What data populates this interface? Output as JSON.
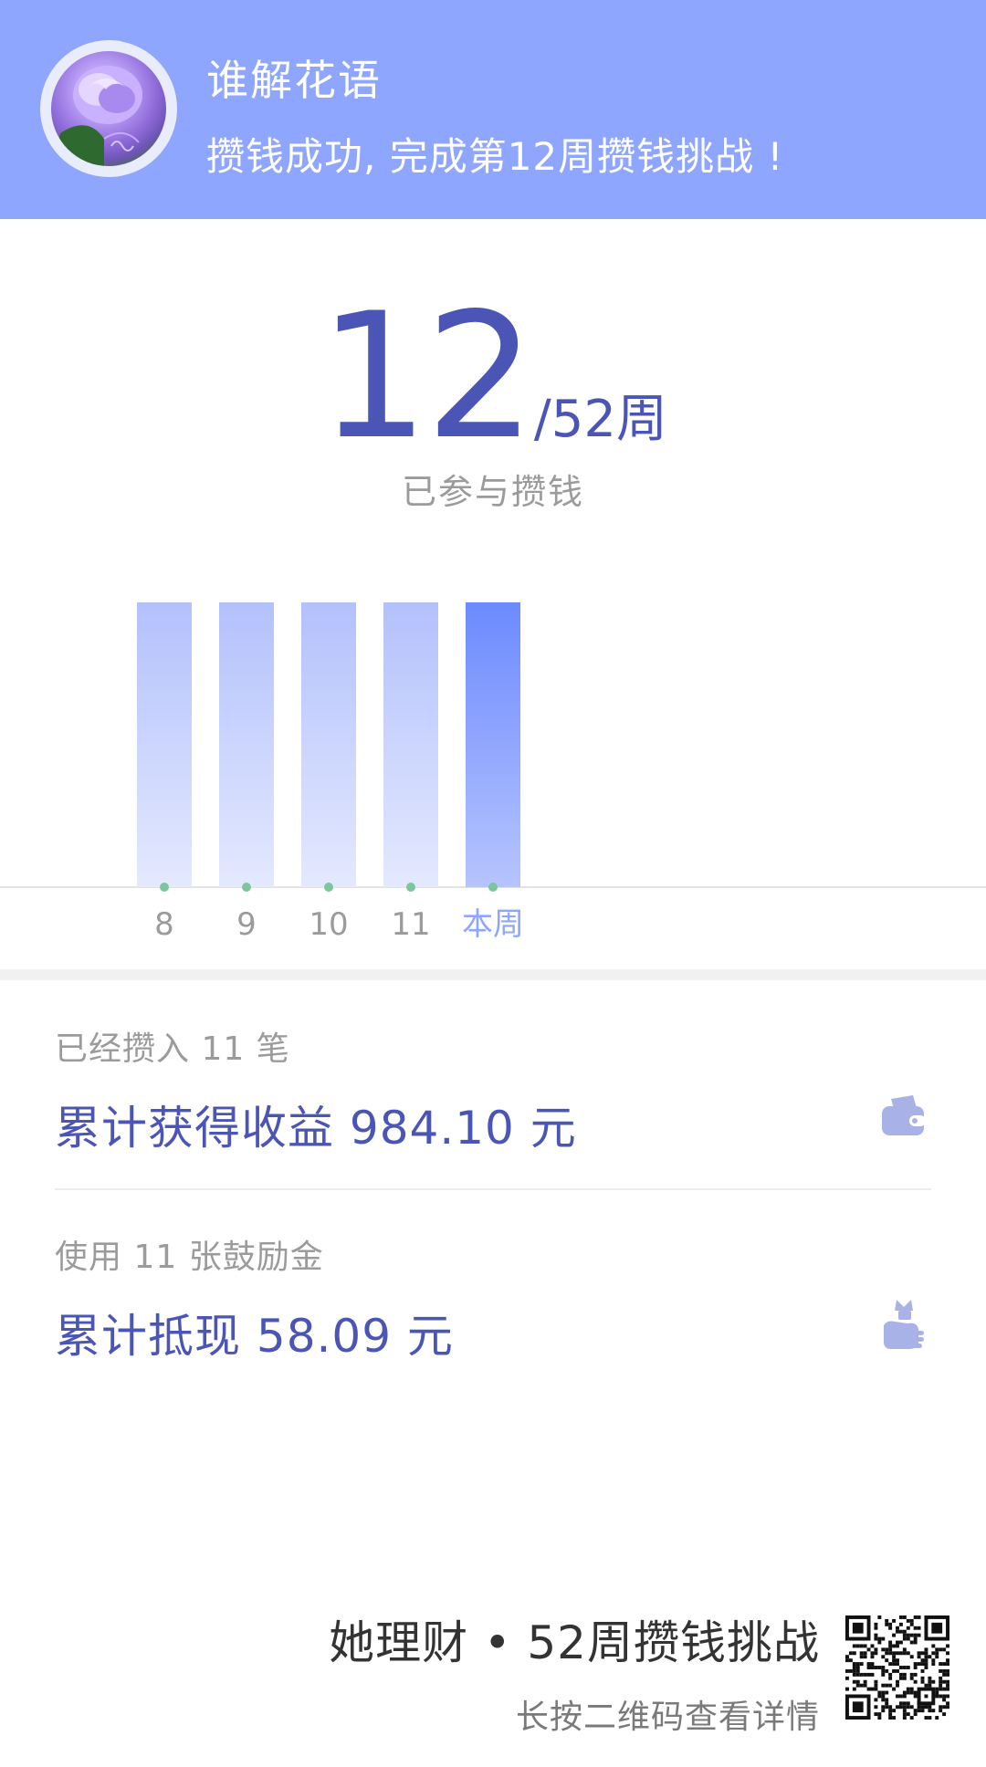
{
  "header": {
    "name": "谁解花语",
    "message": "攒钱成功, 完成第12周攒钱挑战 !",
    "avatar": "purple-rose-avatar",
    "background_color": "#8fa6fe"
  },
  "progress": {
    "current_week": "12",
    "total_suffix": "/52周",
    "caption": "已参与攒钱",
    "color": "#4a55b6"
  },
  "chart_data": {
    "type": "bar",
    "categories": [
      "8",
      "9",
      "10",
      "11",
      "本周"
    ],
    "values": [
      1,
      1,
      1,
      1,
      1
    ],
    "highlight_index": 4,
    "bar_color": "#b7c4fc",
    "highlight_color": "#6f8dfe",
    "marker_color": "#7bc69a",
    "grid": false
  },
  "stats": [
    {
      "sub": "已经攒入 11 笔",
      "main": "累计获得收益 984.10 元",
      "icon": "wallet-icon"
    },
    {
      "sub": "使用 11 张鼓励金",
      "main": "累计抵现 58.09 元",
      "icon": "hand-money-icon"
    }
  ],
  "footer": {
    "title": "她理财 • 52周攒钱挑战",
    "hint": "长按二维码查看详情",
    "qr": "qr-code"
  }
}
